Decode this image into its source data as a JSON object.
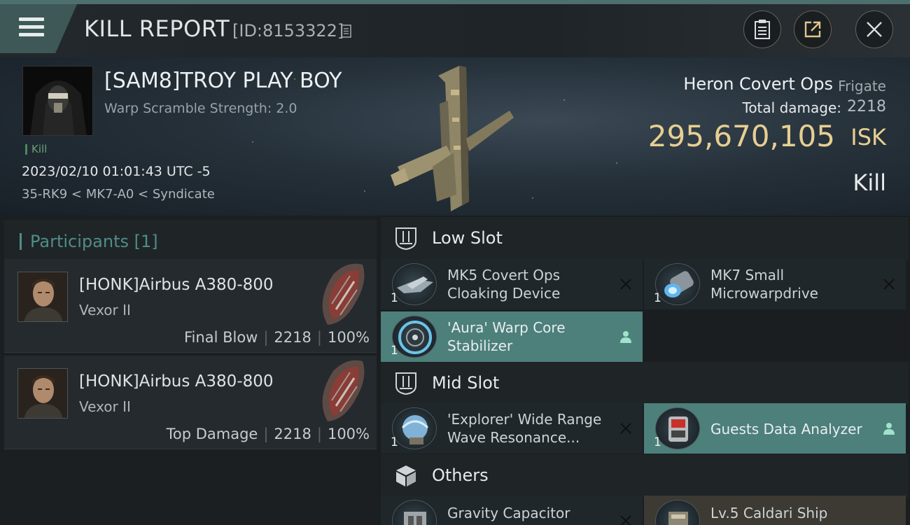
{
  "header": {
    "title": "KILL REPORT",
    "report_id": "[ID:8153322]",
    "icons": [
      "menu-icon",
      "copy-icon",
      "notes-icon",
      "share-icon",
      "close-icon"
    ]
  },
  "victim": {
    "name": "[SAM8]TROY PLAY BOY",
    "warp_scramble": "Warp Scramble Strength: 2.0",
    "tag": "Kill",
    "datetime": "2023/02/10 01:01:43 UTC -5",
    "location": "35-RK9 < MK7-A0 < Syndicate"
  },
  "ship": {
    "name": "Heron Covert Ops",
    "class": "Frigate",
    "damage_label": "Total damage:",
    "damage_value": "2218",
    "isk_value": "295,670,105",
    "isk_unit": "ISK",
    "result": "Kill"
  },
  "participants": {
    "title": "Participants [1]",
    "rows": [
      {
        "name": "[HONK]Airbus A380-800",
        "ship": "Vexor II",
        "role": "Final Blow",
        "damage": "2218",
        "percent": "100%"
      },
      {
        "name": "[HONK]Airbus A380-800",
        "ship": "Vexor II",
        "role": "Top Damage",
        "damage": "2218",
        "percent": "100%"
      }
    ]
  },
  "fitting": {
    "low_slot": {
      "label": "Low Slot",
      "modules": [
        {
          "line1": "MK5 Covert Ops",
          "line2": "Cloaking Device",
          "qty": "1",
          "status": "destroyed",
          "highlight": false
        },
        {
          "line1": "MK7 Small",
          "line2": "Microwarpdrive",
          "qty": "1",
          "status": "destroyed",
          "highlight": false
        },
        {
          "line1": "'Aura' Warp Core",
          "line2": "Stabilizer",
          "qty": "1",
          "status": "dropped",
          "highlight": true
        }
      ]
    },
    "mid_slot": {
      "label": "Mid Slot",
      "modules": [
        {
          "line1": "'Explorer' Wide Range",
          "line2": "Wave Resonance...",
          "qty": "1",
          "status": "destroyed",
          "highlight": false
        },
        {
          "line1": "Guests Data Analyzer",
          "qty": "1",
          "status": "dropped",
          "highlight": true
        }
      ]
    },
    "others": {
      "label": "Others",
      "modules": [
        {
          "line1": "Gravity Capacitor",
          "qty": "",
          "status": "destroyed"
        },
        {
          "line1": "Lv.5 Caldari Ship",
          "qty": "",
          "status": "dropped"
        }
      ]
    }
  },
  "colors": {
    "accent_teal": "#4d7f7b",
    "isk_gold": "#e7cf91",
    "kill_green": "#6aa07a"
  }
}
